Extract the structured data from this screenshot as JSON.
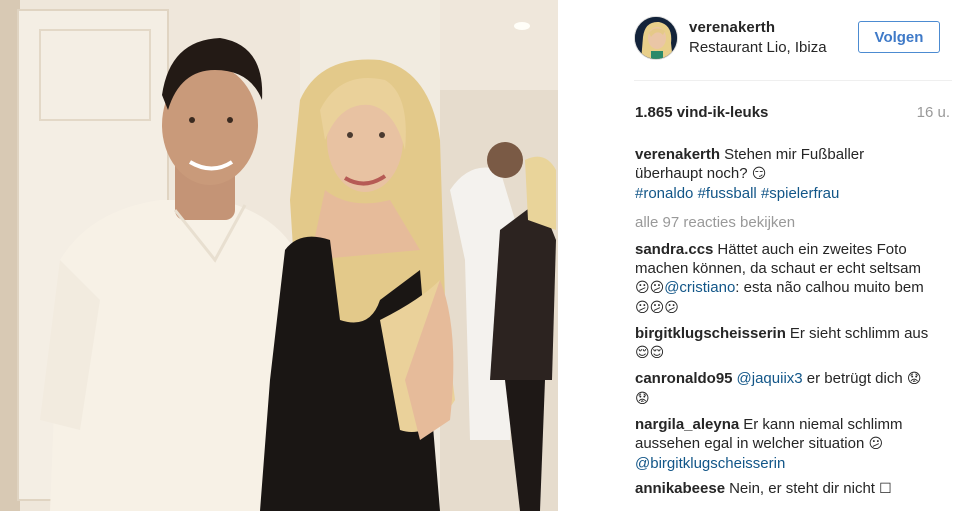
{
  "post": {
    "username": "verenakerth",
    "location": "Restaurant Lio, Ibiza",
    "follow_label": "Volgen",
    "likes": "1.865 vind-ik-leuks",
    "time_ago": "16 u.",
    "view_all_comments": "alle 97 reacties bekijken"
  },
  "caption": {
    "user": "verenakerth",
    "text": "Stehen mir Fußballer überhaupt noch? ",
    "emoji": "😏",
    "hashtags": [
      "#ronaldo",
      "#fussball",
      "#spielerfrau"
    ]
  },
  "comments": [
    {
      "user": "sandra.ccs",
      "t1": "Hättet auch ein zweites Foto machen können, da schaut er echt seltsam ",
      "e1": "😕😕",
      "mention": "@cristiano",
      "t2": ": esta não calhou muito bem ",
      "e2": "😕😕😕"
    },
    {
      "user": "birgitklugscheisserin",
      "t1": "Er sieht schlimm aus",
      "e1": "😌😌"
    },
    {
      "user": "canronaldo95",
      "mention": "@jaquiix3",
      "t1": " er betrügt dich ",
      "e1": "😟😟"
    },
    {
      "user": "nargila_aleyna",
      "t1": "Er kann niemal schlimm aussehen egal in welcher situation ",
      "e1": "😕",
      "mention": "@birgitklugscheisserin"
    },
    {
      "user": "annikabeese",
      "t1": "Nein, er steht dir nicht ",
      "e1": "☐"
    }
  ],
  "icons": {
    "avatar": "profile-photo",
    "emoji_caption": "smirking-face"
  },
  "colors": {
    "link": "#125688",
    "follow_border": "#4c8bd1",
    "follow_text": "#3f7ac8",
    "muted": "#999999"
  }
}
